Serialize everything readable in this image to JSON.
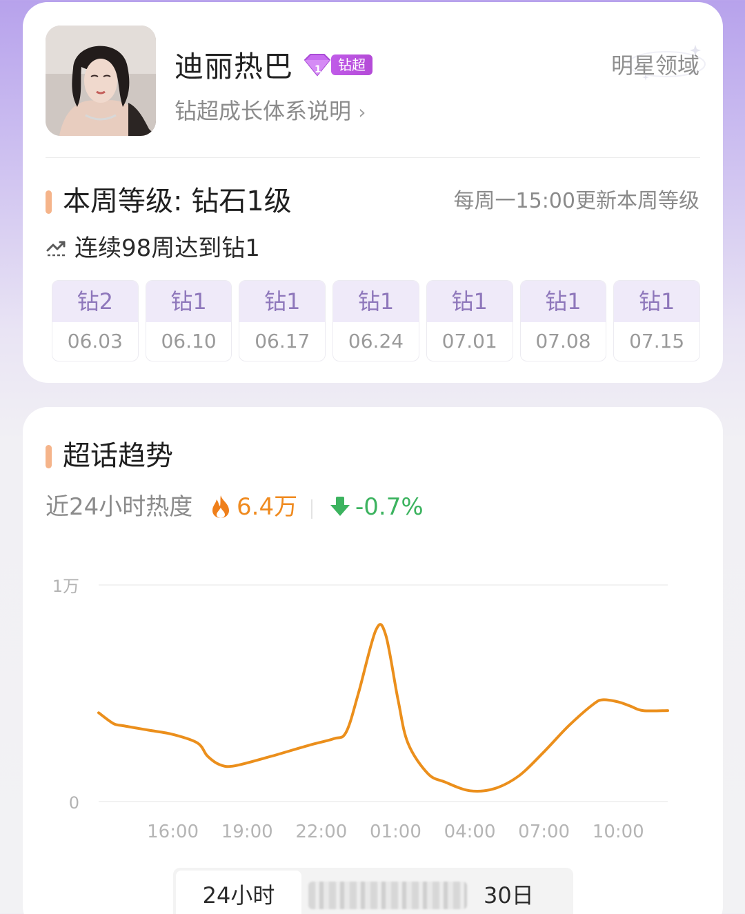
{
  "profile": {
    "name": "迪丽热巴",
    "badge": "钻超",
    "growth_link": "钻超成长体系说明",
    "domain_tag": "明星领域"
  },
  "level": {
    "title": "本周等级: 钻石1级",
    "update_note": "每周一15:00更新本周等级",
    "streak": "连续98周达到钻1",
    "weeks": [
      {
        "level": "钻2",
        "date": "06.03"
      },
      {
        "level": "钻1",
        "date": "06.10"
      },
      {
        "level": "钻1",
        "date": "06.17"
      },
      {
        "level": "钻1",
        "date": "06.24"
      },
      {
        "level": "钻1",
        "date": "07.01"
      },
      {
        "level": "钻1",
        "date": "07.08"
      },
      {
        "level": "钻1",
        "date": "07.15"
      }
    ]
  },
  "trend": {
    "title": "超话趋势",
    "heat_label": "近24小时热度",
    "heat_value": "6.4万",
    "heat_change": "-0.7%",
    "range_tabs": [
      "24小时",
      "30日"
    ]
  },
  "colors": {
    "accent_bar": "#f5b48a",
    "line": "#eb8f1c",
    "heat": "#ef8a1f",
    "down": "#3cb35f",
    "week_level": "#8e77bb"
  },
  "chart_data": {
    "type": "line",
    "y_tick_labels": [
      "0",
      "1万"
    ],
    "ylim": [
      0,
      10000
    ],
    "x_tick_labels": [
      "16:00",
      "19:00",
      "22:00",
      "01:00",
      "04:00",
      "07:00",
      "10:00"
    ],
    "x_tick_hours": [
      3,
      6,
      9,
      12,
      15,
      18,
      21
    ],
    "xlim": [
      0,
      23
    ],
    "grid": true,
    "series": [
      {
        "x": [
          0,
          0.6,
          1,
          2,
          3,
          4,
          4.4,
          4.9,
          5.5,
          7,
          8.5,
          9.5,
          10,
          10.5,
          11.2,
          11.6,
          12.1,
          12.5,
          13.3,
          14,
          15,
          16,
          17,
          18,
          19,
          20,
          20.4,
          21,
          21.5,
          22,
          23
        ],
        "y": [
          4100,
          3600,
          3500,
          3300,
          3100,
          2700,
          2100,
          1700,
          1650,
          2100,
          2600,
          2900,
          3200,
          5000,
          7900,
          7700,
          4700,
          2700,
          1300,
          900,
          500,
          600,
          1200,
          2300,
          3500,
          4500,
          4700,
          4600,
          4400,
          4200,
          4200
        ]
      }
    ]
  }
}
